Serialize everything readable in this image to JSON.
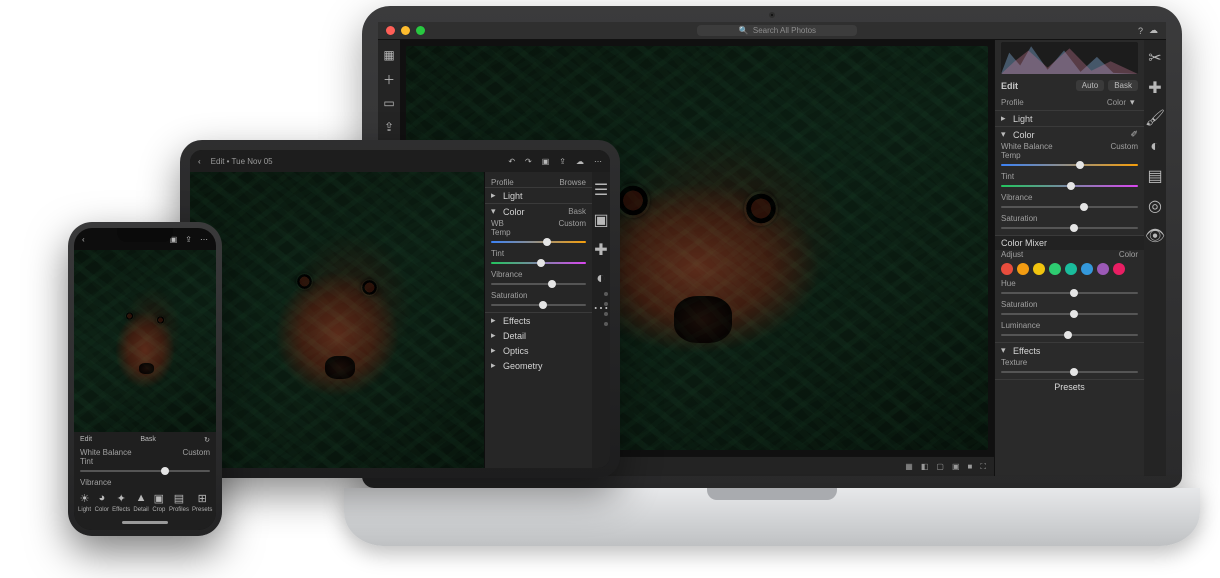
{
  "laptop": {
    "traffic_colors": [
      "#ff5f57",
      "#febc2e",
      "#28c840"
    ],
    "search_placeholder": "Search All Photos",
    "left_rail_icons": [
      "home-icon",
      "plus-icon",
      "book-icon",
      "share-icon",
      "people-icon"
    ],
    "tool_rail_icons": [
      "crop-icon",
      "heal-icon",
      "brush-icon",
      "mask-icon",
      "grad-icon",
      "radial-icon",
      "eye-icon"
    ],
    "panel": {
      "title": "Edit",
      "tabs": [
        "Auto",
        "Bask"
      ],
      "profile_label": "Profile",
      "profile_value": "Color",
      "sections": {
        "light": "Light",
        "color": "Color",
        "wb_label": "White Balance",
        "wb_value": "Custom",
        "temp": "Temp",
        "tint": "Tint",
        "vibrance": "Vibrance",
        "saturation": "Saturation",
        "mixer_title": "Color Mixer",
        "mixer_adjust": "Adjust",
        "mixer_mode": "Color",
        "hue": "Hue",
        "sat2": "Saturation",
        "lum": "Luminance",
        "effects": "Effects",
        "texture": "Texture",
        "presets": "Presets"
      },
      "mixer_colors": [
        "#e84d3d",
        "#f39c12",
        "#f1c40f",
        "#2ecc71",
        "#1abc9c",
        "#3498db",
        "#9b59b6",
        "#e91e63"
      ]
    },
    "status": {
      "dots": 6,
      "right_icons": [
        "grid-icon",
        "compare-icon",
        "single-icon",
        "detail-icon",
        "square-icon",
        "fit-icon"
      ]
    }
  },
  "tablet": {
    "back_label": "Back",
    "title": "Edit • Tue Nov 05",
    "top_icons": [
      "undo-icon",
      "redo-icon",
      "crop-icon",
      "share-icon",
      "cloud-icon",
      "more-icon"
    ],
    "panel": {
      "profile_label": "Profile",
      "profile_value": "Browse",
      "light": "Light",
      "color": "Color",
      "color_mode": "Bask",
      "wb_label": "WB",
      "wb_value": "Custom",
      "temp": "Temp",
      "tint": "Tint",
      "vibrance": "Vibrance",
      "saturation": "Saturation",
      "effects": "Effects",
      "detail": "Detail",
      "optics": "Optics",
      "geometry": "Geometry"
    },
    "tool_icons": [
      "sliders-icon",
      "crop-icon",
      "heal-icon",
      "mask-icon",
      "more-icon"
    ]
  },
  "phone": {
    "top_icons": [
      "undo-icon",
      "crop-icon",
      "share-icon",
      "more-icon"
    ],
    "panel": {
      "edit": "Edit",
      "mode": "Bask",
      "wb_label": "White Balance",
      "wb_value": "Custom",
      "tint": "Tint",
      "vibrance": "Vibrance"
    },
    "tools": [
      {
        "icon": "light-icon",
        "label": "Light"
      },
      {
        "icon": "color-icon",
        "label": "Color"
      },
      {
        "icon": "effects-icon",
        "label": "Effects"
      },
      {
        "icon": "detail-icon",
        "label": "Detail"
      },
      {
        "icon": "crop-icon",
        "label": "Crop"
      },
      {
        "icon": "profile-icon",
        "label": "Profiles"
      },
      {
        "icon": "preset-icon",
        "label": "Presets"
      }
    ]
  }
}
